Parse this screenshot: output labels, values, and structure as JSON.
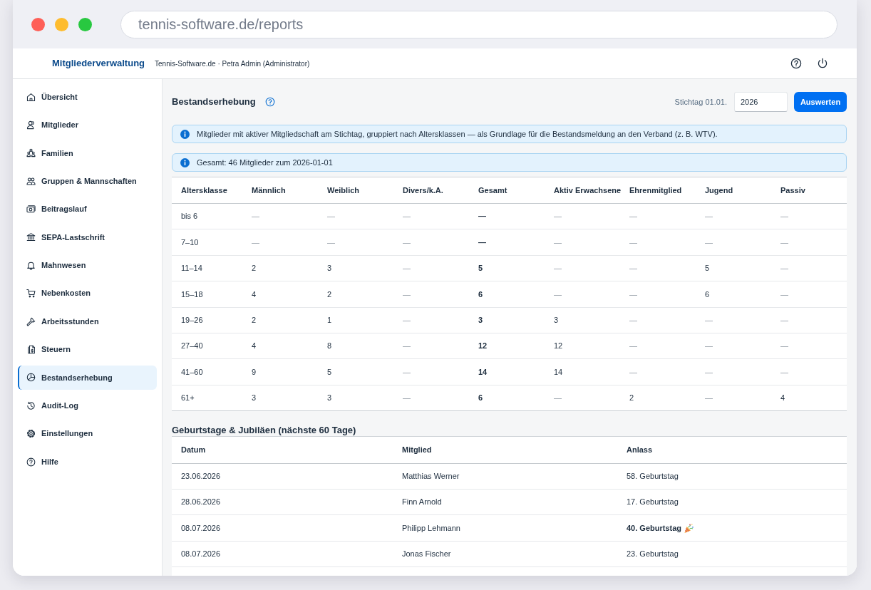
{
  "browser": {
    "url": "tennis-software.de/reports"
  },
  "header": {
    "app_title": "Mitgliederverwaltung",
    "context": "Tennis-Software.de · Petra Admin (Administrator)"
  },
  "sidebar": {
    "items": [
      {
        "label": "Übersicht",
        "selected": false
      },
      {
        "label": "Mitglieder",
        "selected": false
      },
      {
        "label": "Familien",
        "selected": false
      },
      {
        "label": "Gruppen & Mannschaften",
        "selected": false
      },
      {
        "label": "Beitragslauf",
        "selected": false
      },
      {
        "label": "SEPA-Lastschrift",
        "selected": false
      },
      {
        "label": "Mahnwesen",
        "selected": false
      },
      {
        "label": "Nebenkosten",
        "selected": false
      },
      {
        "label": "Arbeitsstunden",
        "selected": false
      },
      {
        "label": "Steuern",
        "selected": false
      },
      {
        "label": "Bestandserhebung",
        "selected": true
      },
      {
        "label": "Audit-Log",
        "selected": false
      },
      {
        "label": "Einstellungen",
        "selected": false
      },
      {
        "label": "Hilfe",
        "selected": false
      }
    ]
  },
  "report": {
    "title": "Bestandserhebung",
    "cutoff_label": "Stichtag 01.01.",
    "year_field": {
      "value": "2026"
    },
    "submit_button": "Auswerten",
    "notices": [
      "Mitglieder mit aktiver Mitgliedschaft am Stichtag, gruppiert nach Altersklassen — als Grundlage für die Bestandsmeldung an den Verband (z. B. WTV).",
      "Gesamt: 46 Mitglieder zum 2026-01-01"
    ],
    "table": {
      "columns": [
        {
          "label": "Altersklasse",
          "bold": false
        },
        {
          "label": "Männlich",
          "bold": false
        },
        {
          "label": "Weiblich",
          "bold": false
        },
        {
          "label": "Divers/k.A.",
          "bold": false
        },
        {
          "label": "Gesamt",
          "bold": true
        },
        {
          "label": "Aktiv Erwachsene",
          "bold": false
        },
        {
          "label": "Ehrenmitglied",
          "bold": false
        },
        {
          "label": "Jugend",
          "bold": false
        },
        {
          "label": "Passiv",
          "bold": false
        }
      ],
      "rows": [
        {
          "cells": [
            {
              "text": "bis 6",
              "muted": false
            },
            {
              "text": "—",
              "muted": true
            },
            {
              "text": "—",
              "muted": true
            },
            {
              "text": "—",
              "muted": true
            },
            {
              "text": "—",
              "muted": false
            },
            {
              "text": "—",
              "muted": true
            },
            {
              "text": "—",
              "muted": true
            },
            {
              "text": "—",
              "muted": true
            },
            {
              "text": "—",
              "muted": true
            }
          ]
        },
        {
          "cells": [
            {
              "text": "7–10",
              "muted": false
            },
            {
              "text": "—",
              "muted": true
            },
            {
              "text": "—",
              "muted": true
            },
            {
              "text": "—",
              "muted": true
            },
            {
              "text": "—",
              "muted": false
            },
            {
              "text": "—",
              "muted": true
            },
            {
              "text": "—",
              "muted": true
            },
            {
              "text": "—",
              "muted": true
            },
            {
              "text": "—",
              "muted": true
            }
          ]
        },
        {
          "cells": [
            {
              "text": "11–14",
              "muted": false
            },
            {
              "text": "2",
              "muted": false
            },
            {
              "text": "3",
              "muted": false
            },
            {
              "text": "—",
              "muted": true
            },
            {
              "text": "5",
              "muted": false
            },
            {
              "text": "—",
              "muted": true
            },
            {
              "text": "—",
              "muted": true
            },
            {
              "text": "5",
              "muted": false
            },
            {
              "text": "—",
              "muted": true
            }
          ]
        },
        {
          "cells": [
            {
              "text": "15–18",
              "muted": false
            },
            {
              "text": "4",
              "muted": false
            },
            {
              "text": "2",
              "muted": false
            },
            {
              "text": "—",
              "muted": true
            },
            {
              "text": "6",
              "muted": false
            },
            {
              "text": "—",
              "muted": true
            },
            {
              "text": "—",
              "muted": true
            },
            {
              "text": "6",
              "muted": false
            },
            {
              "text": "—",
              "muted": true
            }
          ]
        },
        {
          "cells": [
            {
              "text": "19–26",
              "muted": false
            },
            {
              "text": "2",
              "muted": false
            },
            {
              "text": "1",
              "muted": false
            },
            {
              "text": "—",
              "muted": true
            },
            {
              "text": "3",
              "muted": false
            },
            {
              "text": "3",
              "muted": false
            },
            {
              "text": "—",
              "muted": true
            },
            {
              "text": "—",
              "muted": true
            },
            {
              "text": "—",
              "muted": true
            }
          ]
        },
        {
          "cells": [
            {
              "text": "27–40",
              "muted": false
            },
            {
              "text": "4",
              "muted": false
            },
            {
              "text": "8",
              "muted": false
            },
            {
              "text": "—",
              "muted": true
            },
            {
              "text": "12",
              "muted": false
            },
            {
              "text": "12",
              "muted": false
            },
            {
              "text": "—",
              "muted": true
            },
            {
              "text": "—",
              "muted": true
            },
            {
              "text": "—",
              "muted": true
            }
          ]
        },
        {
          "cells": [
            {
              "text": "41–60",
              "muted": false
            },
            {
              "text": "9",
              "muted": false
            },
            {
              "text": "5",
              "muted": false
            },
            {
              "text": "—",
              "muted": true
            },
            {
              "text": "14",
              "muted": false
            },
            {
              "text": "14",
              "muted": false
            },
            {
              "text": "—",
              "muted": true
            },
            {
              "text": "—",
              "muted": true
            },
            {
              "text": "—",
              "muted": true
            }
          ]
        },
        {
          "cells": [
            {
              "text": "61+",
              "muted": false
            },
            {
              "text": "3",
              "muted": false
            },
            {
              "text": "3",
              "muted": false
            },
            {
              "text": "—",
              "muted": true
            },
            {
              "text": "6",
              "muted": false
            },
            {
              "text": "—",
              "muted": true
            },
            {
              "text": "2",
              "muted": false
            },
            {
              "text": "—",
              "muted": true
            },
            {
              "text": "4",
              "muted": false
            }
          ]
        }
      ]
    }
  },
  "upcoming": {
    "title": "Geburtstage & Jubiläen (nächste 60 Tage)",
    "table": {
      "columns": [
        "Datum",
        "Mitglied",
        "Anlass"
      ],
      "rows": [
        {
          "date": "23.06.2026",
          "member": "Matthias Werner",
          "occasion": "58. Geburtstag",
          "milestone": false
        },
        {
          "date": "28.06.2026",
          "member": "Finn Arnold",
          "occasion": "17. Geburtstag",
          "milestone": false
        },
        {
          "date": "08.07.2026",
          "member": "Philipp Lehmann",
          "occasion": "40. Geburtstag",
          "milestone": true
        },
        {
          "date": "08.07.2026",
          "member": "Jonas Fischer",
          "occasion": "23. Geburtstag",
          "milestone": false
        }
      ]
    }
  }
}
